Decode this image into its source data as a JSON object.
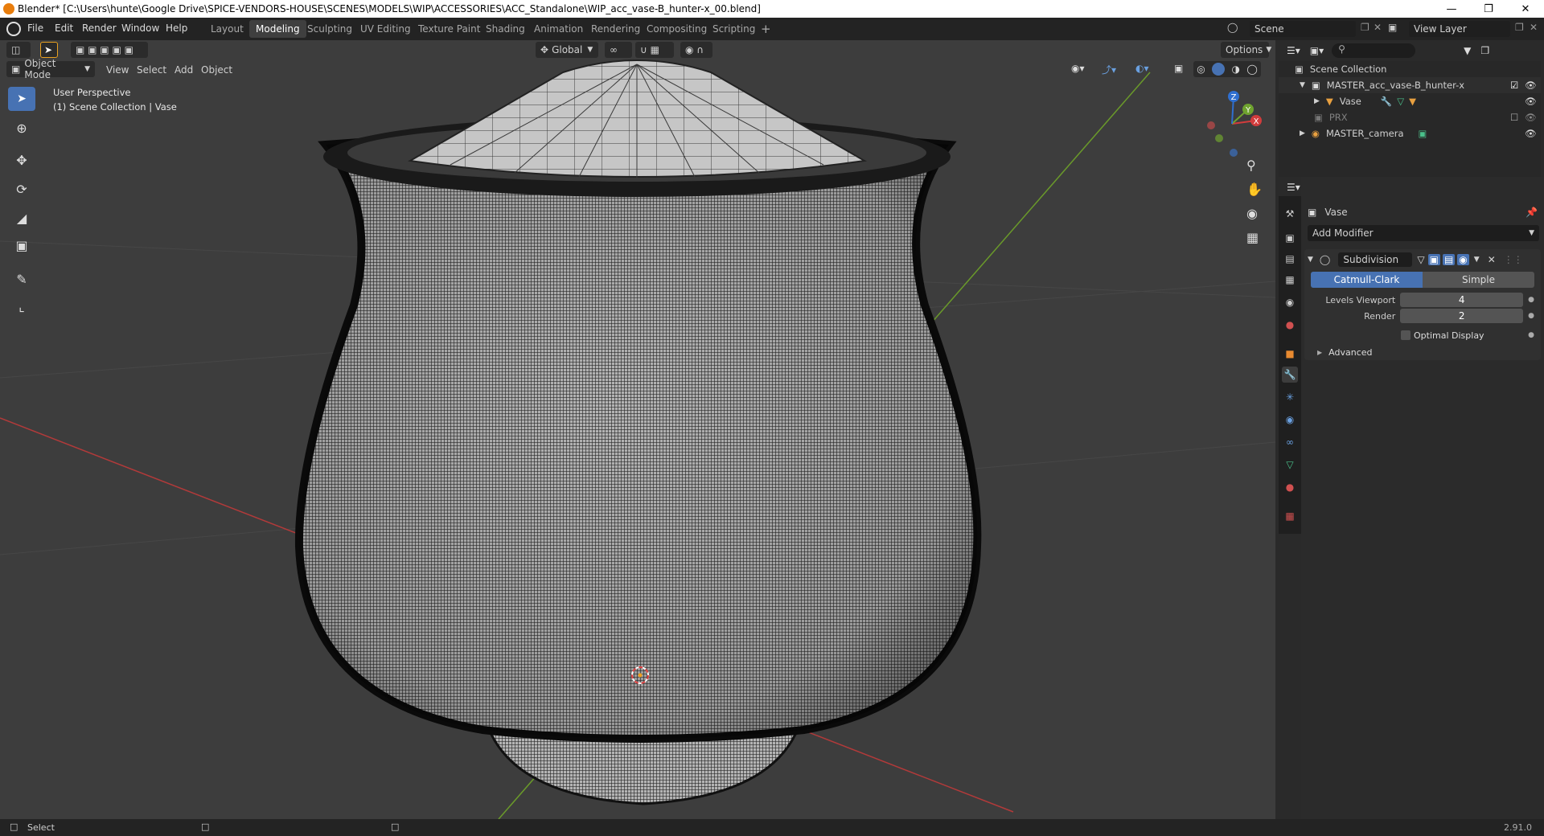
{
  "window": {
    "title": "Blender* [C:\\Users\\hunte\\Google Drive\\SPICE-VENDORS-HOUSE\\SCENES\\MODELS\\WIP\\ACCESSORIES\\ACC_Standalone\\WIP_acc_vase-B_hunter-x_00.blend]"
  },
  "menu": [
    "File",
    "Edit",
    "Render",
    "Window",
    "Help"
  ],
  "workspaces": [
    "Layout",
    "Modeling",
    "Sculpting",
    "UV Editing",
    "Texture Paint",
    "Shading",
    "Animation",
    "Rendering",
    "Compositing",
    "Scripting"
  ],
  "active_workspace": "Modeling",
  "scene": {
    "name": "Scene",
    "view_layer": "View Layer"
  },
  "viewport": {
    "mode": "Object Mode",
    "menus": [
      "View",
      "Select",
      "Add",
      "Object"
    ],
    "transform_orientation": "Global",
    "options_label": "Options",
    "overlay_line1": "User Perspective",
    "overlay_line2": "(1) Scene Collection | Vase",
    "gizmo": {
      "x": "X",
      "y": "Y",
      "z": "Z"
    }
  },
  "outliner": {
    "root": "Scene Collection",
    "items": [
      {
        "label": "MASTER_acc_vase-B_hunter-x",
        "indent": 1,
        "expanded": true
      },
      {
        "label": "Vase",
        "indent": 2,
        "expanded": false
      },
      {
        "label": "PRX",
        "indent": 1,
        "expanded": false,
        "muted": true
      },
      {
        "label": "MASTER_camera",
        "indent": 1,
        "expanded": false
      }
    ]
  },
  "properties": {
    "object_name": "Vase",
    "add_modifier": "Add Modifier",
    "modifier_name": "Subdivision",
    "algo_options": [
      "Catmull-Clark",
      "Simple"
    ],
    "algo_selected": "Catmull-Clark",
    "levels_viewport_label": "Levels Viewport",
    "levels_viewport_value": "4",
    "render_label": "Render",
    "render_value": "2",
    "optimal_display": "Optimal Display",
    "advanced": "Advanced"
  },
  "status": {
    "left": "Select",
    "version": "2.91.0"
  },
  "colors": {
    "accent": "#4772b3",
    "x_axis": "#c0392b",
    "y_axis": "#6fa32f",
    "z_axis": "#2f6fd0"
  }
}
